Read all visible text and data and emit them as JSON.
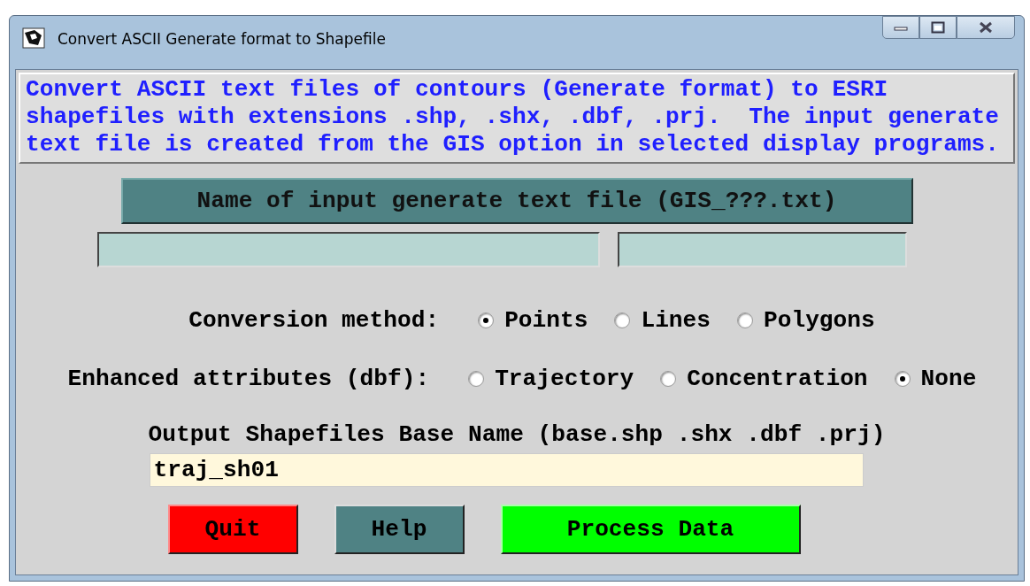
{
  "window": {
    "title": "Convert ASCII Generate format to Shapefile"
  },
  "description": "Convert ASCII text files of contours (Generate format) to ESRI\nshapefiles with extensions .shp, .shx, .dbf, .prj.  The input generate\ntext file is created from the GIS option in selected display programs.",
  "input_file": {
    "label": "Name of input generate text file (GIS_???.txt)"
  },
  "conversion_method": {
    "label": "Conversion method:",
    "options": [
      {
        "label": "Points",
        "selected": true
      },
      {
        "label": "Lines",
        "selected": false
      },
      {
        "label": "Polygons",
        "selected": false
      }
    ]
  },
  "enhanced_attributes": {
    "label": "Enhanced attributes (dbf):",
    "options": [
      {
        "label": "Trajectory",
        "selected": false
      },
      {
        "label": "Concentration",
        "selected": false
      },
      {
        "label": "None",
        "selected": true
      }
    ]
  },
  "output": {
    "label": "Output Shapefiles Base Name (base.shp .shx .dbf .prj)",
    "value": "traj_sh01"
  },
  "buttons": [
    {
      "label": "Quit",
      "kind": "quit"
    },
    {
      "label": "Help",
      "kind": "help"
    },
    {
      "label": "Process Data",
      "kind": "process"
    }
  ]
}
